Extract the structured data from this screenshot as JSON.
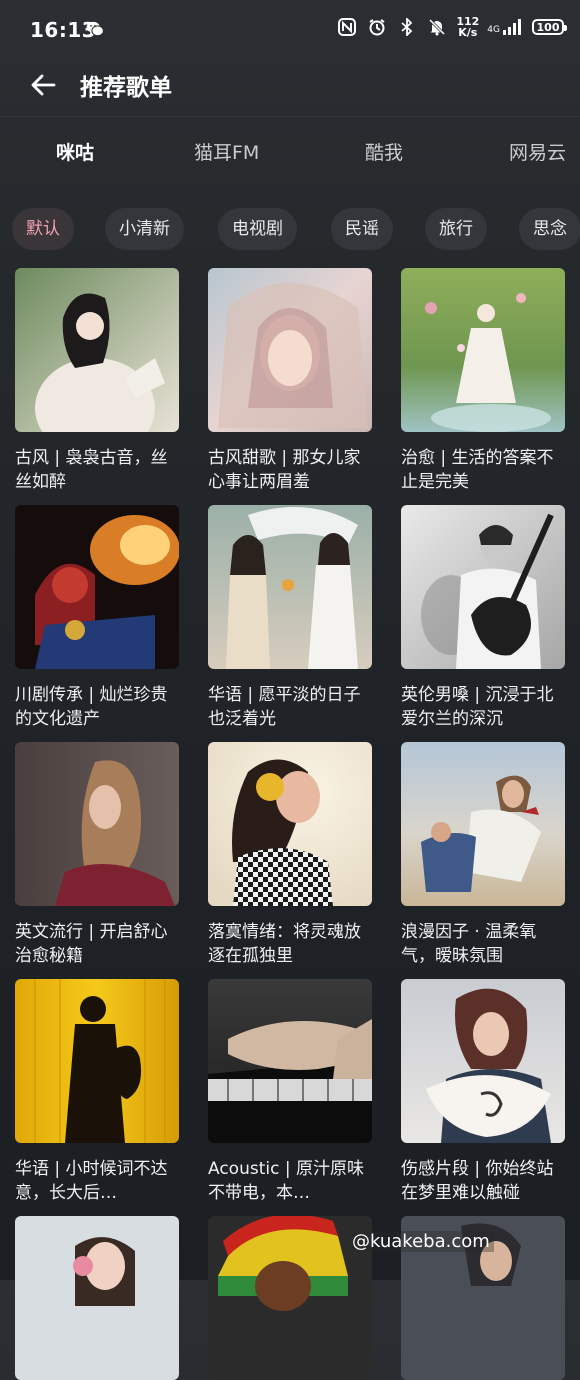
{
  "status": {
    "time": "16:13",
    "net_speed_value": "112",
    "net_speed_unit": "K/s",
    "signal_label": "4G",
    "battery": "100"
  },
  "header": {
    "title": "推荐歌单"
  },
  "source_tabs": [
    {
      "label": "咪咕",
      "active": true
    },
    {
      "label": "猫耳FM",
      "active": false
    },
    {
      "label": "酷我",
      "active": false
    },
    {
      "label": "网易云",
      "active": false
    }
  ],
  "chips": [
    {
      "label": "默认",
      "active": true
    },
    {
      "label": "小清新",
      "active": false
    },
    {
      "label": "电视剧",
      "active": false
    },
    {
      "label": "民谣",
      "active": false
    },
    {
      "label": "旅行",
      "active": false
    },
    {
      "label": "思念",
      "active": false
    }
  ],
  "playlists": [
    {
      "title": "古风 | 袅袅古音，丝丝如醉"
    },
    {
      "title": "古风甜歌 | 那女儿家心事让两眉羞"
    },
    {
      "title": "治愈 | 生活的答案不止是完美"
    },
    {
      "title": "川剧传承 | 灿烂珍贵的文化遗产"
    },
    {
      "title": "华语 | 愿平淡的日子也泛着光"
    },
    {
      "title": "英伦男嗓 | 沉浸于北爱尔兰的深沉"
    },
    {
      "title": "英文流行 | 开启舒心治愈秘籍"
    },
    {
      "title": "落寞情绪：将灵魂放逐在孤独里"
    },
    {
      "title": "浪漫因子 · 温柔氧气，暧昧氛围"
    },
    {
      "title": "华语 | 小时候词不达意，长大后…"
    },
    {
      "title": "Acoustic | 原汁原味不带电，本…"
    },
    {
      "title": "伤感片段 | 你始终站在梦里难以触碰"
    }
  ],
  "watermark": "@kuakeba.com",
  "colors": {
    "background": "#1f2327",
    "chip_bg": "#33373b",
    "chip_active_text": "#f2a3b4",
    "text_primary": "#ffffff"
  }
}
